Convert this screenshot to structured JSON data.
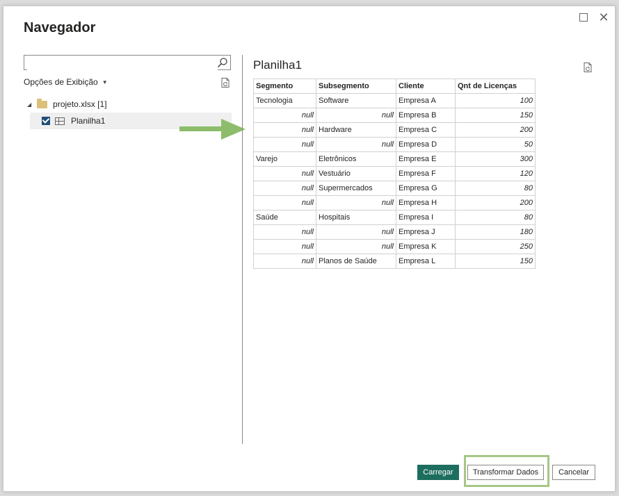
{
  "dialog": {
    "title": "Navegador",
    "maximize_icon": "maximize-icon",
    "close_glyph": "✕"
  },
  "left_panel": {
    "search": {
      "value": "",
      "placeholder": "",
      "icon": "search-icon"
    },
    "display_options_label": "Opções de Exibição",
    "refresh_icon": "refresh-icon",
    "tree": {
      "file_label": "projeto.xlsx [1]",
      "sheet_label": "Planilha1",
      "sheet_checked": true
    }
  },
  "preview": {
    "title": "Planilha1",
    "columns": [
      "Segmento",
      "Subsegmento",
      "Cliente",
      "Qnt de Licenças"
    ],
    "rows": [
      [
        "Tecnologia",
        "Software",
        "Empresa A",
        "100"
      ],
      [
        "null",
        "null",
        "Empresa B",
        "150"
      ],
      [
        "null",
        "Hardware",
        "Empresa C",
        "200"
      ],
      [
        "null",
        "null",
        "Empresa D",
        "50"
      ],
      [
        "Varejo",
        "Eletrônicos",
        "Empresa E",
        "300"
      ],
      [
        "null",
        "Vestuário",
        "Empresa F",
        "120"
      ],
      [
        "null",
        "Supermercados",
        "Empresa G",
        "80"
      ],
      [
        "null",
        "null",
        "Empresa H",
        "200"
      ],
      [
        "Saúde",
        "Hospitais",
        "Empresa I",
        "80"
      ],
      [
        "null",
        "null",
        "Empresa J",
        "180"
      ],
      [
        "null",
        "null",
        "Empresa K",
        "250"
      ],
      [
        "null",
        "Planos de Saúde",
        "Empresa L",
        "150"
      ]
    ]
  },
  "footer": {
    "load_label": "Carregar",
    "transform_label": "Transformar Dados",
    "cancel_label": "Cancelar"
  },
  "colors": {
    "accent": "#1d6e5f",
    "highlight": "#a6c785",
    "arrow": "#8dbd6b"
  }
}
